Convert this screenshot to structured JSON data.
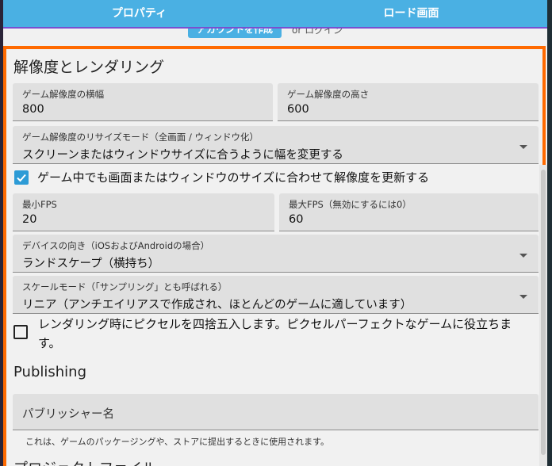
{
  "tabs": [
    {
      "label": "プロパティ"
    },
    {
      "label": "ロード画面"
    }
  ],
  "behind": {
    "button_label": "アカウントを作成",
    "text": "or ログイン"
  },
  "rendering": {
    "title": "解像度とレンダリング",
    "width": {
      "label": "ゲーム解像度の横幅",
      "value": "800"
    },
    "height": {
      "label": "ゲーム解像度の高さ",
      "value": "600"
    },
    "resize_mode": {
      "label": "ゲーム解像度のリサイズモード（全画面 / ウィンドウ化）",
      "value": "スクリーンまたはウィンドウサイズに合うように幅を変更する"
    },
    "update_resolution": {
      "label": "ゲーム中でも画面またはウィンドウのサイズに合わせて解像度を更新する",
      "checked": true
    },
    "min_fps": {
      "label": "最小FPS",
      "value": "20"
    },
    "max_fps": {
      "label": "最大FPS（無効にするには0）",
      "value": "60"
    },
    "orientation": {
      "label": "デバイスの向き（iOSおよびAndroidの場合）",
      "value": "ランドスケープ（横持ち）"
    },
    "scale_mode": {
      "label": "スケールモード（「サンプリング」とも呼ばれる）",
      "value": "リニア（アンチエイリアスで作成され、ほとんどのゲームに適しています）"
    },
    "round_pixels": {
      "label": "レンダリング時にピクセルを四捨五入します。ピクセルパーフェクトなゲームに役立ちます。",
      "checked": false
    }
  },
  "publishing": {
    "title": "Publishing",
    "publisher": {
      "placeholder": "パブリッシャー名"
    },
    "helper": "これは、ゲームのパッケージングや、ストアに提出するときに使用されます。",
    "next_title": "プロジェクトファイル"
  },
  "colors": {
    "tab_bg": "#4ab0e3",
    "accent_frame": "#ff6a00",
    "checkbox_on": "#2d9bd6"
  }
}
